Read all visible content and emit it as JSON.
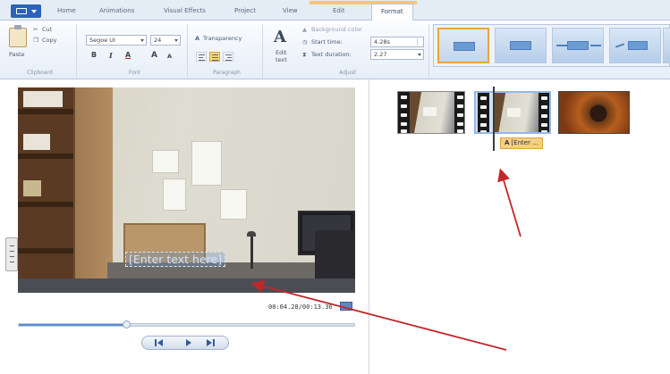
{
  "tabs": [
    {
      "label": "Home",
      "active": false
    },
    {
      "label": "Animations",
      "active": false
    },
    {
      "label": "Visual Effects",
      "active": false
    },
    {
      "label": "Project",
      "active": false
    },
    {
      "label": "View",
      "active": false
    },
    {
      "label": "Edit",
      "active": false
    },
    {
      "label": "Format",
      "active": true
    }
  ],
  "ribbon": {
    "clipboard": {
      "paste": "Paste",
      "cut": "Cut",
      "copy": "Copy",
      "group": "Clipboard"
    },
    "font": {
      "family": "Segoe UI",
      "size": "24",
      "bold": "B",
      "italic": "I",
      "color": "A",
      "grow": "A",
      "shrink": "A",
      "group": "Font"
    },
    "paragraph": {
      "transparency": "Transparency",
      "group": "Paragraph"
    },
    "adjust": {
      "edit_text_line1": "Edit",
      "edit_text_line2": "text",
      "background_color": "Background color",
      "start_time_label": "Start time:",
      "start_time_value": "4.28s",
      "text_duration_label": "Text duration:",
      "text_duration_value": "2.27",
      "group": "Adjust"
    }
  },
  "preview": {
    "overlay_text": "[Enter text here]",
    "timecode": "00:04.28/00:13.36",
    "seek_progress": 0.32
  },
  "storyboard": {
    "caption_chip_icon": "A",
    "caption_chip_text": "[Enter ..."
  },
  "colors": {
    "accent_blue": "#2b63b8",
    "annotation_arrow": "#c0282a",
    "selection_orange": "#e9a53b",
    "caption_chip": "#f5ce86"
  },
  "icons": [
    "file-menu-icon",
    "paste-icon",
    "cut-icon",
    "copy-icon",
    "edit-text-icon",
    "paint-bucket-icon",
    "clock-icon",
    "text-duration-icon",
    "fullscreen-icon",
    "previous-frame-icon",
    "play-icon",
    "next-frame-icon",
    "caption-icon"
  ]
}
